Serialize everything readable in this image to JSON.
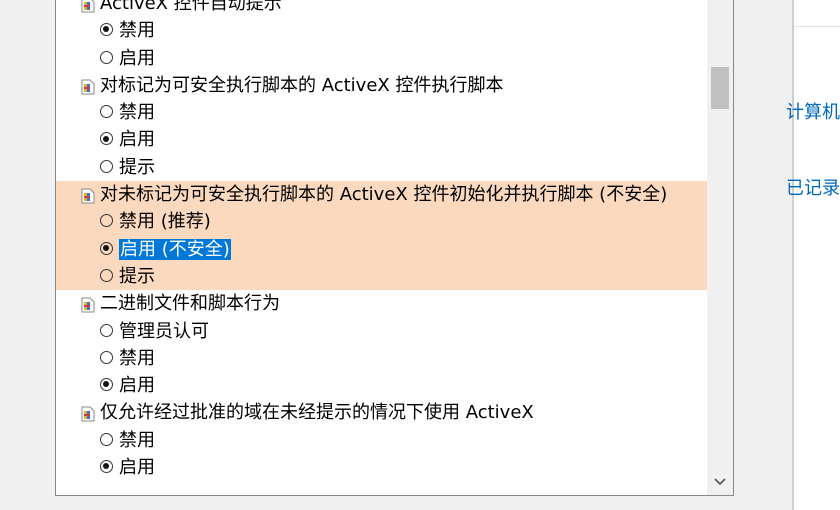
{
  "background": {
    "link1": "计算机",
    "link2": "已记录"
  },
  "settings": [
    {
      "type": "group",
      "label": "ActiveX 控件自动提示"
    },
    {
      "type": "option",
      "label": "禁用",
      "checked": true
    },
    {
      "type": "option",
      "label": "启用",
      "checked": false
    },
    {
      "type": "group",
      "label": "对标记为可安全执行脚本的 ActiveX 控件执行脚本"
    },
    {
      "type": "option",
      "label": "禁用",
      "checked": false
    },
    {
      "type": "option",
      "label": "启用",
      "checked": true
    },
    {
      "type": "option",
      "label": "提示",
      "checked": false
    },
    {
      "type": "group",
      "label": "对未标记为可安全执行脚本的 ActiveX 控件初始化并执行脚本 (不安全)",
      "highlight": true
    },
    {
      "type": "option",
      "label": "禁用 (推荐)",
      "checked": false,
      "highlight": true
    },
    {
      "type": "option",
      "label": "启用 (不安全)",
      "checked": true,
      "highlight": true,
      "selected": true
    },
    {
      "type": "option",
      "label": "提示",
      "checked": false,
      "highlight": true
    },
    {
      "type": "group",
      "label": "二进制文件和脚本行为"
    },
    {
      "type": "option",
      "label": "管理员认可",
      "checked": false
    },
    {
      "type": "option",
      "label": "禁用",
      "checked": false
    },
    {
      "type": "option",
      "label": "启用",
      "checked": true
    },
    {
      "type": "group",
      "label": "仅允许经过批准的域在未经提示的情况下使用 ActiveX"
    },
    {
      "type": "option",
      "label": "禁用",
      "checked": false
    },
    {
      "type": "option",
      "label": "启用",
      "checked": true
    }
  ]
}
